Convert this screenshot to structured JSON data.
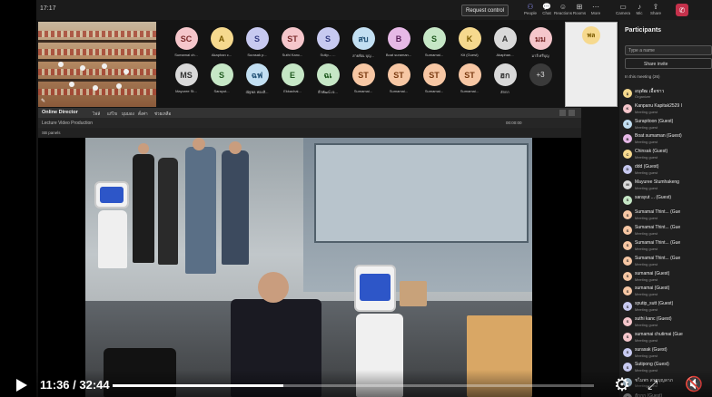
{
  "topbar": {
    "clock": "17:17",
    "request_control": "Request control",
    "items": [
      {
        "label": "People",
        "icon": "people-icon",
        "glyph": "⚇",
        "active": true
      },
      {
        "label": "Chat",
        "icon": "chat-icon",
        "glyph": "💬",
        "active": false
      },
      {
        "label": "Reactions",
        "icon": "reactions-icon",
        "glyph": "☺",
        "active": false
      },
      {
        "label": "Rooms",
        "icon": "rooms-icon",
        "glyph": "⊞",
        "active": false
      },
      {
        "label": "More",
        "icon": "more-icon",
        "glyph": "⋯",
        "active": false
      },
      {
        "label": "Camera",
        "icon": "camera-icon",
        "glyph": "▭",
        "active": false
      },
      {
        "label": "Mic",
        "icon": "mic-icon",
        "glyph": "♪",
        "active": false
      },
      {
        "label": "Share",
        "icon": "share-icon",
        "glyph": "⇪",
        "active": false
      }
    ],
    "leave_icon": "phone-hangup-icon",
    "leave_glyph": "✆"
  },
  "gallery": {
    "row1": [
      {
        "initials": "SC",
        "name": "Sumamai ch...",
        "color": "#f5c6cb",
        "text": "#7a2a2a"
      },
      {
        "initials": "A",
        "name": "Akaphan c...",
        "color": "#f6d98e",
        "text": "#7a5a00"
      },
      {
        "initials": "S",
        "name": "Surasak p...",
        "color": "#c7c9f0",
        "text": "#333a80"
      },
      {
        "initials": "ST",
        "name": "Suthi Kanc...",
        "color": "#f5c6cb",
        "text": "#7a2a2a"
      },
      {
        "initials": "S",
        "name": "Sutip... ...",
        "color": "#c7c9f0",
        "text": "#333a80"
      },
      {
        "initials": "สบ",
        "name": "สายพิณ บุญ...",
        "color": "#c2dff2",
        "text": "#1f4f73"
      },
      {
        "initials": "B",
        "name": "Boat suraman...",
        "color": "#e6b8e6",
        "text": "#5a1f5a"
      },
      {
        "initials": "S",
        "name": "Sumamai...",
        "color": "#c6e7c6",
        "text": "#1f5a1f"
      },
      {
        "initials": "K",
        "name": "Kit (Guest)",
        "color": "#f6d98e",
        "text": "#7a5a00"
      },
      {
        "initials": "A",
        "name": "Akaphan...",
        "color": "#d9d9d9",
        "text": "#333"
      },
      {
        "initials": "มม",
        "name": "มาลี ศรีบุญ",
        "color": "#f5c6cb",
        "text": "#7a2a2a"
      }
    ],
    "row2": [
      {
        "initials": "MS",
        "name": "Mayuree St...",
        "color": "#d9d9d9",
        "text": "#333"
      },
      {
        "initials": "S",
        "name": "Sarayut...",
        "color": "#c6e7c6",
        "text": "#1f5a1f"
      },
      {
        "initials": "ฉฟ",
        "name": "ณัฐพล ฟองสิ...",
        "color": "#c2dff2",
        "text": "#1f4f73"
      },
      {
        "initials": "E",
        "name": "Ekkachai...",
        "color": "#c6e7c6",
        "text": "#1f5a1f"
      },
      {
        "initials": "ฉเ",
        "name": "ธีรพัฒน์ เจ...",
        "color": "#c6e7c6",
        "text": "#1f5a1f"
      },
      {
        "initials": "ST",
        "name": "Sumamai...",
        "color": "#f7c7a4",
        "text": "#7a3a10"
      },
      {
        "initials": "ST",
        "name": "Sumamai...",
        "color": "#f7c7a4",
        "text": "#7a3a10"
      },
      {
        "initials": "ST",
        "name": "Sumamai...",
        "color": "#f7c7a4",
        "text": "#7a3a10"
      },
      {
        "initials": "ST",
        "name": "Sumamai...",
        "color": "#f7c7a4",
        "text": "#7a3a10"
      },
      {
        "initials": "ฮก",
        "name": "ฮักกก",
        "color": "#d9d9d9",
        "text": "#333"
      }
    ],
    "more_label": "+3",
    "self_initials": "พล"
  },
  "participants": {
    "title": "Participants",
    "search_placeholder": "Type a name",
    "share_invite": "Share invite",
    "section": "In this meeting (26)",
    "items": [
      {
        "initials": "อ",
        "name": "อนุพัฒ เอื้อชาว",
        "sub": "Organizer",
        "color": "#f6d98e"
      },
      {
        "initials": "K",
        "name": "Kanpanu Kapitak2529 I",
        "sub": "Meeting guest",
        "color": "#f5c6cb"
      },
      {
        "initials": "S",
        "name": "Surapitoon (Guest)",
        "sub": "Meeting guest",
        "color": "#c2dff2"
      },
      {
        "initials": "B",
        "name": "Boat sumaman (Guest)",
        "sub": "Meeting guest",
        "color": "#e6b8e6"
      },
      {
        "initials": "C",
        "name": "Chinsak (Guest)",
        "sub": "Meeting guest",
        "color": "#f6d98e"
      },
      {
        "initials": "D",
        "name": "ddd (Guest)",
        "sub": "Meeting guest",
        "color": "#c7c9f0"
      },
      {
        "initials": "M",
        "name": "Mayuree Stumhakeng",
        "sub": "Meeting guest",
        "color": "#d9d9d9"
      },
      {
        "initials": "S",
        "name": "sarayut ... (Guest)",
        "sub": "",
        "color": "#c6e7c6"
      },
      {
        "initials": "S",
        "name": "Sumamai Thint... (Gue",
        "sub": "Meeting guest",
        "color": "#f7c7a4"
      },
      {
        "initials": "S",
        "name": "Sumamai Thint... (Gue",
        "sub": "Meeting guest",
        "color": "#f7c7a4"
      },
      {
        "initials": "S",
        "name": "Sumamai Thint... (Gue",
        "sub": "Meeting guest",
        "color": "#f7c7a4"
      },
      {
        "initials": "S",
        "name": "Sumamai Thint... (Gue",
        "sub": "Meeting guest",
        "color": "#f7c7a4"
      },
      {
        "initials": "S",
        "name": "sumamai (Guest)",
        "sub": "Meeting guest",
        "color": "#f7c7a4"
      },
      {
        "initials": "S",
        "name": "sumamai (Guest)",
        "sub": "Meeting guest",
        "color": "#f7c7a4"
      },
      {
        "initials": "S",
        "name": "sputip_sutt (Guest)",
        "sub": "Meeting guest",
        "color": "#c7c9f0"
      },
      {
        "initials": "S",
        "name": "suthi kanc (Guest)",
        "sub": "Meeting guest",
        "color": "#f5c6cb"
      },
      {
        "initials": "S",
        "name": "sumamai chutimai (Gue",
        "sub": "Meeting guest",
        "color": "#f5c6cb"
      },
      {
        "initials": "S",
        "name": "surasak (Guest)",
        "sub": "Meeting guest",
        "color": "#c7c9f0"
      },
      {
        "initials": "S",
        "name": "Sutipong (Guest)",
        "sub": "Meeting guest",
        "color": "#c7c9f0"
      },
      {
        "initials": "ช",
        "name": "ชไมพร สายบุญลาภ",
        "sub": "Meeting guest",
        "color": "#c2dff2"
      },
      {
        "initials": "ฮ",
        "name": "ฮักกก (Guest)",
        "sub": "Meeting guest",
        "color": "#d9d9d9"
      }
    ]
  },
  "shared_window": {
    "app_title": "Online Director",
    "menus": [
      "ไฟล์",
      "แก้ไข",
      "มุมมอง",
      "ตั้งค่า",
      "ช่วยเหลือ"
    ],
    "subtitle": "Lecture Video Production",
    "status": "00:00:00",
    "source_label": "SB panels"
  },
  "player": {
    "time": "11:36 / 32:44",
    "progress": 0.354,
    "play_icon": "play-icon",
    "settings_icon": "gear-icon",
    "fullscreen_icon": "fullscreen-icon",
    "volume_icon": "volume-muted-icon",
    "settings_glyph": "⚙",
    "fullscreen_glyph": "⤢",
    "volume_glyph": "🔇"
  }
}
